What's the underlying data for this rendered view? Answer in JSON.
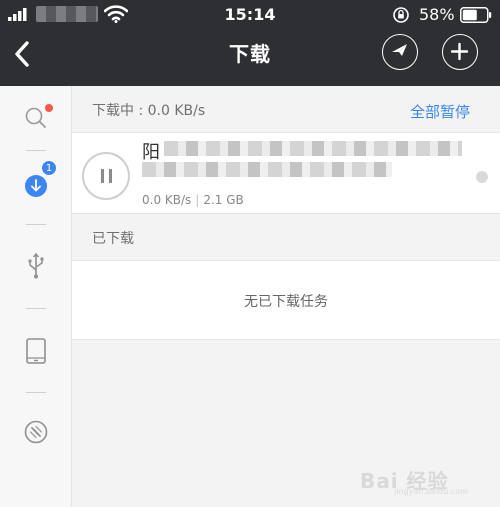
{
  "status_bar": {
    "time": "15:14",
    "battery_percent": "58%",
    "icons": [
      "signal-icon",
      "wifi-icon",
      "rotation-lock-icon",
      "battery-icon"
    ]
  },
  "nav": {
    "title": "下载",
    "icons": [
      "back-icon",
      "share-icon",
      "add-icon"
    ]
  },
  "sidebar": {
    "items": [
      {
        "name": "search",
        "icon": "search-icon",
        "has_dot": true
      },
      {
        "name": "download",
        "icon": "download-icon",
        "badge": "1",
        "active": true
      },
      {
        "name": "usb",
        "icon": "usb-icon"
      },
      {
        "name": "tablet",
        "icon": "tablet-icon"
      },
      {
        "name": "speed",
        "icon": "speedometer-icon"
      }
    ]
  },
  "downloading": {
    "label": "下载中 : 0.0 KB/s",
    "pause_all": "全部暂停",
    "task": {
      "title_visible": "阳",
      "speed": "0.0 KB/s",
      "size": "2.1 GB",
      "state": "paused"
    }
  },
  "downloaded": {
    "label": "已下载",
    "empty_message": "无已下载任务"
  },
  "watermark": {
    "text": "Bai 经验",
    "url": "jingyan.baidu.com"
  },
  "colors": {
    "header_bg": "#2e2f33",
    "accent": "#3b86f0",
    "notify_red": "#f05a4a"
  }
}
